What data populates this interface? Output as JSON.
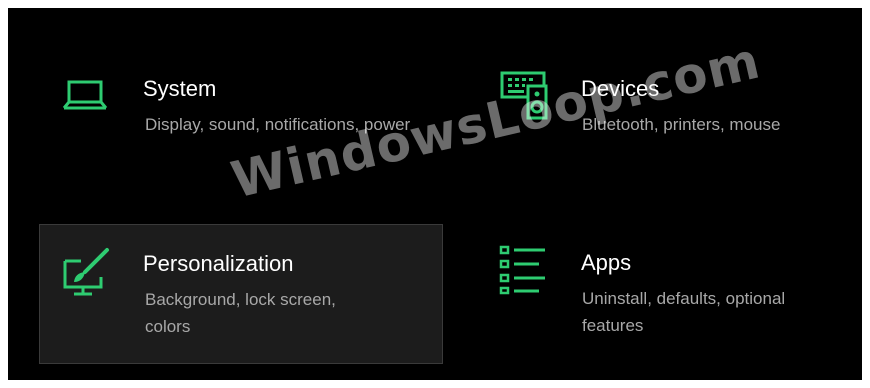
{
  "settings": {
    "accent_color": "#2ecc71",
    "tiles": [
      {
        "title": "System",
        "description": "Display, sound, notifications, power",
        "icon": "laptop-icon"
      },
      {
        "title": "Devices",
        "description": "Bluetooth, printers, mouse",
        "icon": "devices-icon"
      },
      {
        "title": "Personalization",
        "description": "Background, lock screen, colors",
        "icon": "personalization-icon",
        "state": "hovered"
      },
      {
        "title": "Apps",
        "description": "Uninstall, defaults, optional features",
        "icon": "apps-list-icon"
      }
    ]
  },
  "watermark": {
    "text": "WindowsLoop.com"
  }
}
